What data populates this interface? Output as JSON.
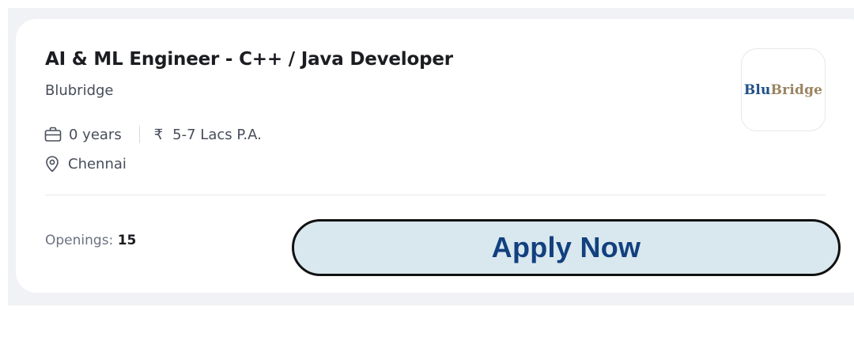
{
  "job": {
    "title": "AI & ML Engineer - C++ / Java Developer",
    "company": "Blubridge",
    "experience": "0 years",
    "currency_symbol": "₹",
    "salary": "5-7 Lacs P.A.",
    "location": "Chennai",
    "openings_label": "Openings:",
    "openings_count": "15"
  },
  "logo": {
    "text_part1": "Blu",
    "text_part2": "Bridge"
  },
  "actions": {
    "apply_label": "Apply Now"
  },
  "icons": {
    "experience": "briefcase-icon",
    "salary": "rupee-icon",
    "location": "location-pin-icon"
  },
  "colors": {
    "title": "#1b1d21",
    "secondary_text": "#474d59",
    "apply_button_bg": "#d9e8ee",
    "apply_button_text": "#12407f",
    "logo_blue": "#1f4e86",
    "logo_gold": "#9b8460"
  }
}
